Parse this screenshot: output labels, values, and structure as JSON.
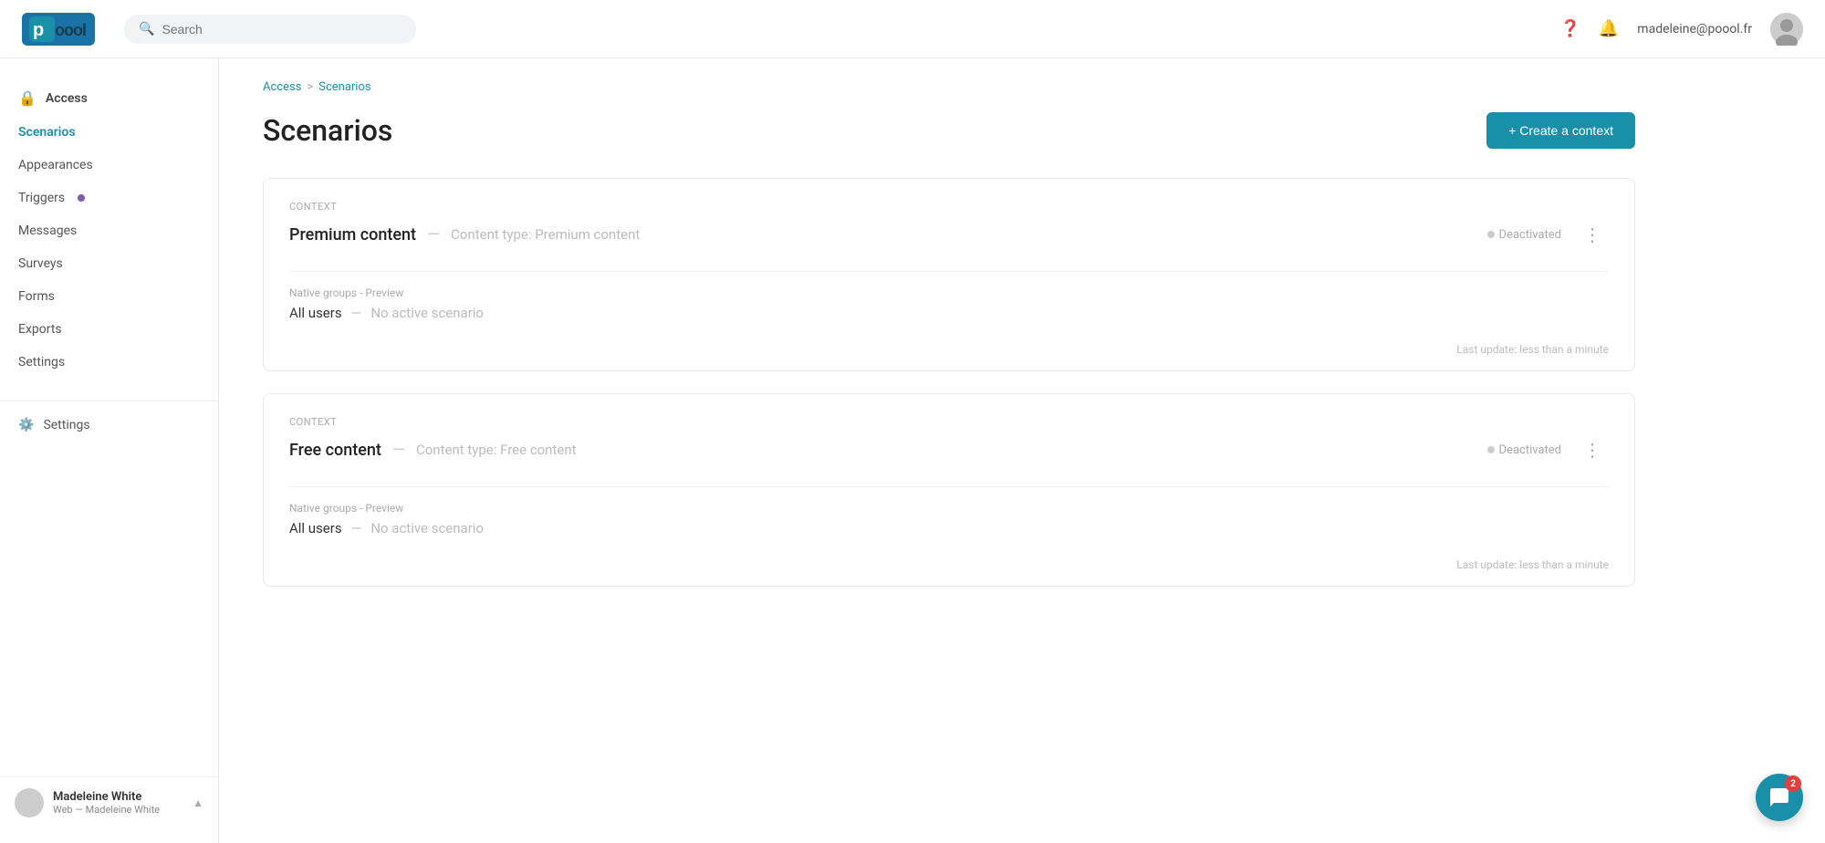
{
  "topbar": {
    "logo_text": "poool",
    "search_placeholder": "Search",
    "user_email": "madeleine@poool.fr"
  },
  "sidebar": {
    "access_label": "Access",
    "items": [
      {
        "id": "scenarios",
        "label": "Scenarios",
        "active": true
      },
      {
        "id": "appearances",
        "label": "Appearances",
        "active": false
      },
      {
        "id": "triggers",
        "label": "Triggers",
        "active": false,
        "dot": true
      },
      {
        "id": "messages",
        "label": "Messages",
        "active": false
      },
      {
        "id": "surveys",
        "label": "Surveys",
        "active": false
      },
      {
        "id": "forms",
        "label": "Forms",
        "active": false
      },
      {
        "id": "exports",
        "label": "Exports",
        "active": false
      },
      {
        "id": "settings-sub",
        "label": "Settings",
        "active": false
      }
    ],
    "settings_label": "Settings",
    "user_name": "Madeleine White",
    "user_sub": "Web — Madeleine White"
  },
  "breadcrumb": {
    "parent": "Access",
    "separator": ">",
    "current": "Scenarios"
  },
  "page": {
    "title": "Scenarios",
    "create_button": "+ Create a context"
  },
  "cards": [
    {
      "context_label": "Context",
      "name": "Premium content",
      "separator": "—",
      "type": "Content type: Premium content",
      "status": "Deactivated",
      "group_label": "Native groups - Preview",
      "group_name": "All users",
      "group_sep": "—",
      "group_status": "No active scenario",
      "last_update": "Last update: less than a minute"
    },
    {
      "context_label": "Context",
      "name": "Free content",
      "separator": "—",
      "type": "Content type: Free content",
      "status": "Deactivated",
      "group_label": "Native groups - Preview",
      "group_name": "All users",
      "group_sep": "—",
      "group_status": "No active scenario",
      "last_update": "Last update: less than a minute"
    }
  ],
  "chat": {
    "badge": "2"
  }
}
